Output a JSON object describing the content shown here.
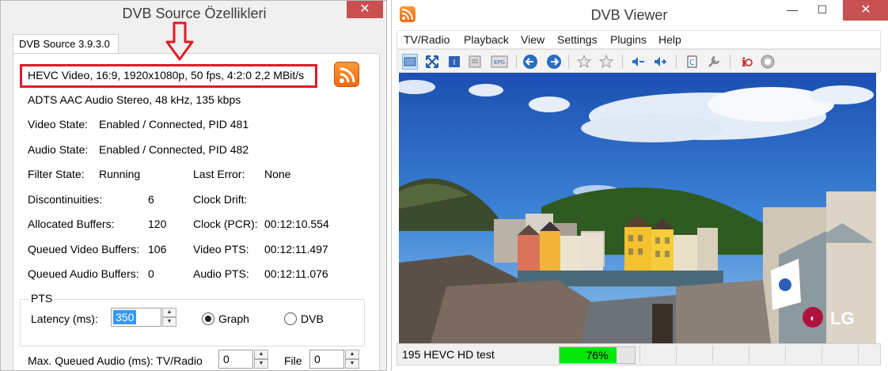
{
  "dialog": {
    "title": "DVB Source Özellikleri",
    "close_label": "✕",
    "tab_label": "DVB Source 3.9.3.0",
    "video_info": "HEVC Video, 16:9, 1920x1080p, 50 fps, 4:2:0   2,2 MBit/s",
    "audio_info": "ADTS AAC Audio Stereo, 48 kHz, 135 kbps",
    "rows": {
      "video_state_label": "Video State:",
      "video_state_value": "Enabled / Connected, PID 481",
      "audio_state_label": "Audio State:",
      "audio_state_value": "Enabled / Connected, PID 482",
      "filter_state_label": "Filter State:",
      "filter_state_value": "Running",
      "last_error_label": "Last Error:",
      "last_error_value": "None",
      "discontinuities_label": "Discontinuities:",
      "discontinuities_value": "6",
      "clock_drift_label": "Clock Drift:",
      "clock_drift_value": "",
      "allocated_buffers_label": "Allocated Buffers:",
      "allocated_buffers_value": "120",
      "clock_pcr_label": "Clock (PCR):",
      "clock_pcr_value": "00:12:10.554",
      "queued_video_label": "Queued Video Buffers:",
      "queued_video_value": "106",
      "video_pts_label": "Video PTS:",
      "video_pts_value": "00:12:11.497",
      "queued_audio_label": "Queued Audio Buffers:",
      "queued_audio_value": "0",
      "audio_pts_label": "Audio PTS:",
      "audio_pts_value": "00:12:11.076"
    },
    "pts_group": {
      "title": "PTS",
      "latency_label": "Latency (ms):",
      "latency_value": "350",
      "graph_label": "Graph",
      "dvb_label": "DVB",
      "selected": "Graph"
    },
    "max_queued_label": "Max. Queued Audio (ms): TV/Radio",
    "tv_radio_value": "0",
    "file_label": "File",
    "file_value": "0"
  },
  "viewer": {
    "title": "DVB Viewer",
    "menu": [
      "TV/Radio",
      "Playback",
      "View",
      "Settings",
      "Plugins",
      "Help"
    ],
    "channel": "195 HEVC HD test",
    "signal_percent": 76,
    "signal_label": "76%",
    "logo_text": "LG"
  },
  "colors": {
    "highlight": "#e01b24",
    "progress_fill": "#06e606",
    "close_red": "#c75050",
    "accent_orange": "#f07a1a"
  }
}
